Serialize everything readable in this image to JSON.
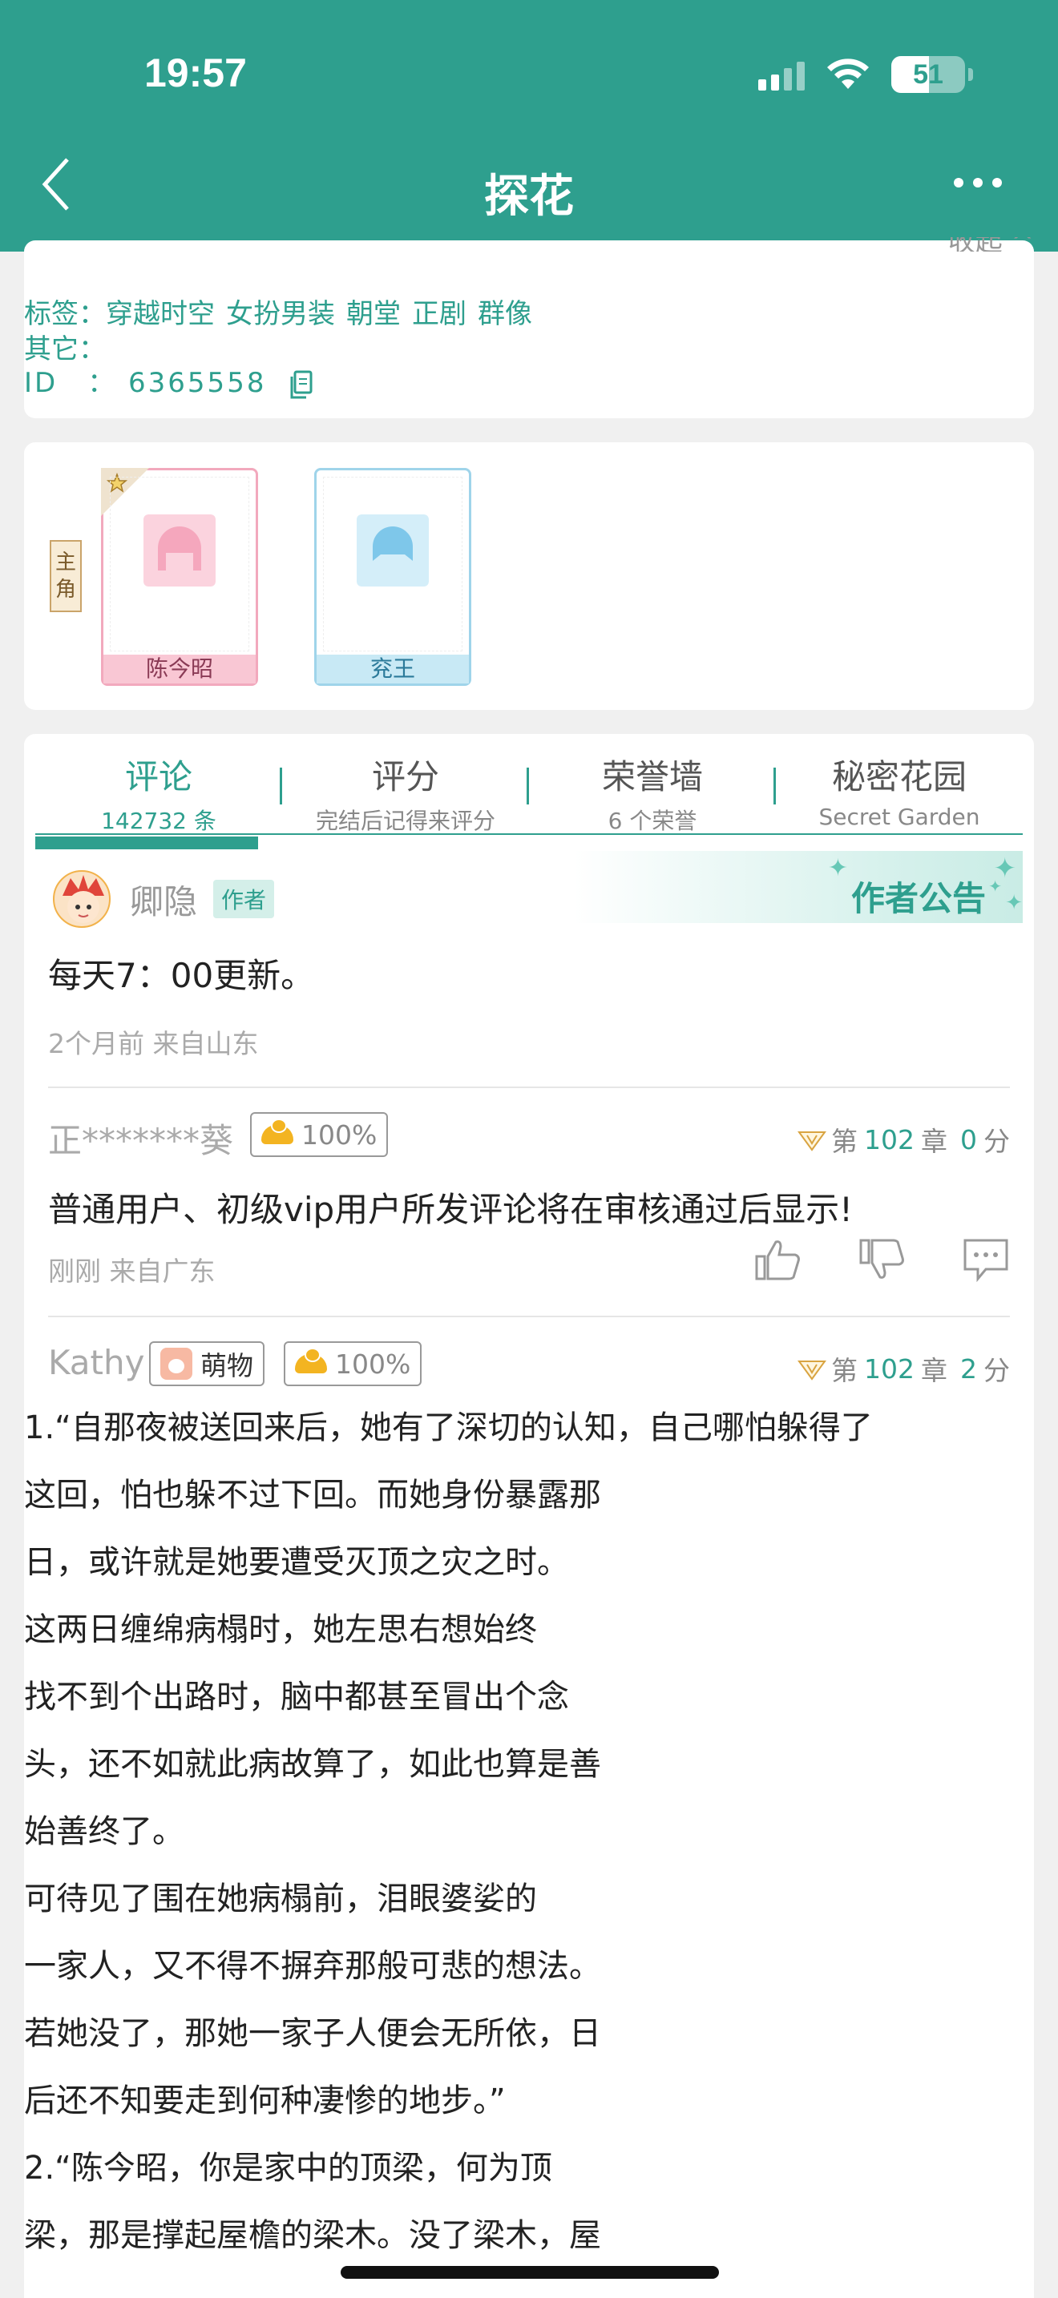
{
  "status_bar": {
    "time": "19:57",
    "battery": "51"
  },
  "header": {
    "title": "探花"
  },
  "info": {
    "cut_text": "收起 ^",
    "tags_label": "标签：",
    "tags": [
      "穿越时空",
      "女扮男装",
      "朝堂",
      "正剧",
      "群像"
    ],
    "other_label": "其它：",
    "id_label": "ID　：",
    "id_value": "6365558"
  },
  "roles": {
    "label_1": "主",
    "label_2": "角",
    "items": [
      {
        "name": "陈今昭",
        "theme": "pink"
      },
      {
        "name": "兖王",
        "theme": "blue"
      }
    ]
  },
  "tabs": [
    {
      "label": "评论",
      "sub": "142732 条",
      "active": true
    },
    {
      "label": "评分",
      "sub": "完结后记得来评分",
      "active": false
    },
    {
      "label": "荣誉墙",
      "sub": "6 个荣誉",
      "active": false
    },
    {
      "label": "秘密花园",
      "sub": "Secret Garden",
      "active": false
    }
  ],
  "notice": {
    "banner": "作者公告",
    "author": "卿隐",
    "badge": "作者",
    "body": "每天7：00更新。",
    "meta": "2个月前  来自山东"
  },
  "comment1": {
    "user": "正*******葵",
    "pill": "100%",
    "chap_prefix": "第",
    "chap_num": "102",
    "chap_suffix": "章",
    "score_num": "0",
    "score_unit": "分",
    "body": "普通用户、初级vip用户所发评论将在审核通过后显示!",
    "meta": "刚刚  来自广东"
  },
  "comment2": {
    "user": "Kathy",
    "badge": "萌物",
    "pill": "100%",
    "chap_prefix": "第",
    "chap_num": "102",
    "chap_suffix": "章",
    "score_num": "2",
    "score_unit": "分",
    "lines": [
      "1.“自那夜被送回来后，她有了深切的认知，自己哪怕躲得了",
      "这回，怕也躲不过下回。而她身份暴露那",
      "日，或许就是她要遭受灭顶之灾之时。",
      "这两日缠绵病榻时，她左思右想始终",
      "找不到个出路时，脑中都甚至冒出个念",
      "头，还不如就此病故算了，如此也算是善",
      "始善终了。",
      "可待见了围在她病榻前，泪眼婆娑的",
      "一家人，又不得不摒弃那般可悲的想法。",
      "若她没了，那她一家子人便会无所依，日",
      "后还不知要走到何种凄惨的地步。”",
      "2.“陈今昭，你是家中的顶梁，何为顶",
      "梁，那是撑起屋檐的梁木。没了梁木，屋"
    ]
  },
  "colors": {
    "brand": "#2e9f8e",
    "accent_gold": "#f3b421"
  }
}
